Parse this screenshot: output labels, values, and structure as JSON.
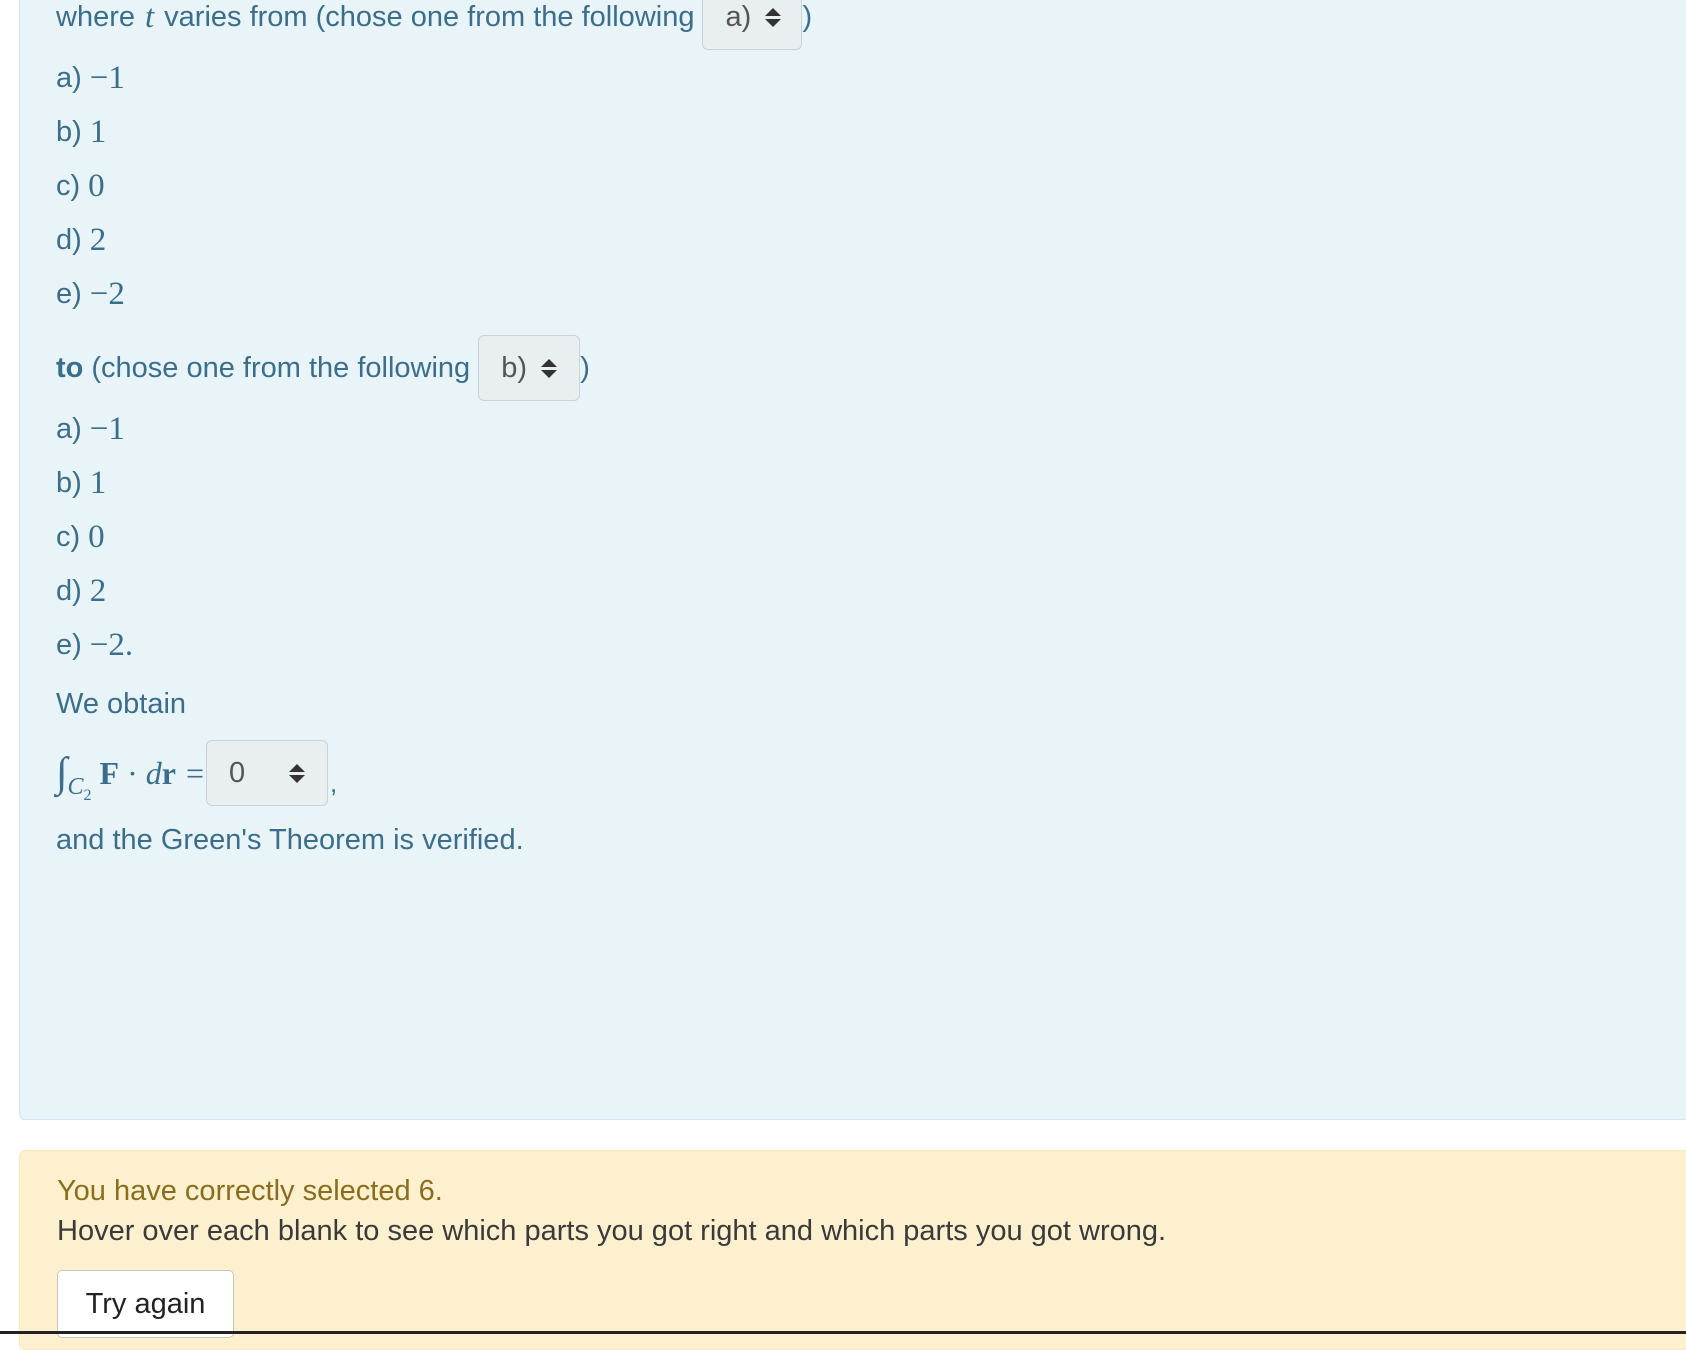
{
  "from_line": {
    "prefix": "where",
    "variable": "t",
    "text": "varies from (chose one from the following",
    "select_value": "a)",
    "close": ")"
  },
  "from_options": [
    {
      "label": "a)",
      "value": "−1"
    },
    {
      "label": "b)",
      "value": "1"
    },
    {
      "label": "c)",
      "value": "0"
    },
    {
      "label": "d)",
      "value": "2"
    },
    {
      "label": "e)",
      "value": "−2"
    }
  ],
  "to_line": {
    "bold": "to",
    "text": "(chose one from the following",
    "select_value": "b)",
    "close": ")"
  },
  "to_options": [
    {
      "label": "a)",
      "value": "−1"
    },
    {
      "label": "b)",
      "value": "1"
    },
    {
      "label": "c)",
      "value": "0"
    },
    {
      "label": "d)",
      "value": "2"
    },
    {
      "label": "e)",
      "value": "−2."
    }
  ],
  "obtain_text": "We obtain",
  "integral": {
    "symbol": "∫",
    "subscript": "C",
    "sub_sub": "2",
    "field": "F",
    "dot": "·",
    "d": "d",
    "r": "r",
    "equals": "=",
    "select_value": "0",
    "trailing": ","
  },
  "conclusion": "and the Green's Theorem is verified.",
  "feedback": {
    "title": "You have correctly selected 6.",
    "message": "Hover over each blank to see which parts you got right and which parts you got wrong.",
    "button": "Try again"
  },
  "colors": {
    "question_bg": "#e8f4f8",
    "text": "#3b6e8a",
    "feedback_bg": "#fcf0cf",
    "feedback_title": "#8a6d1d"
  }
}
